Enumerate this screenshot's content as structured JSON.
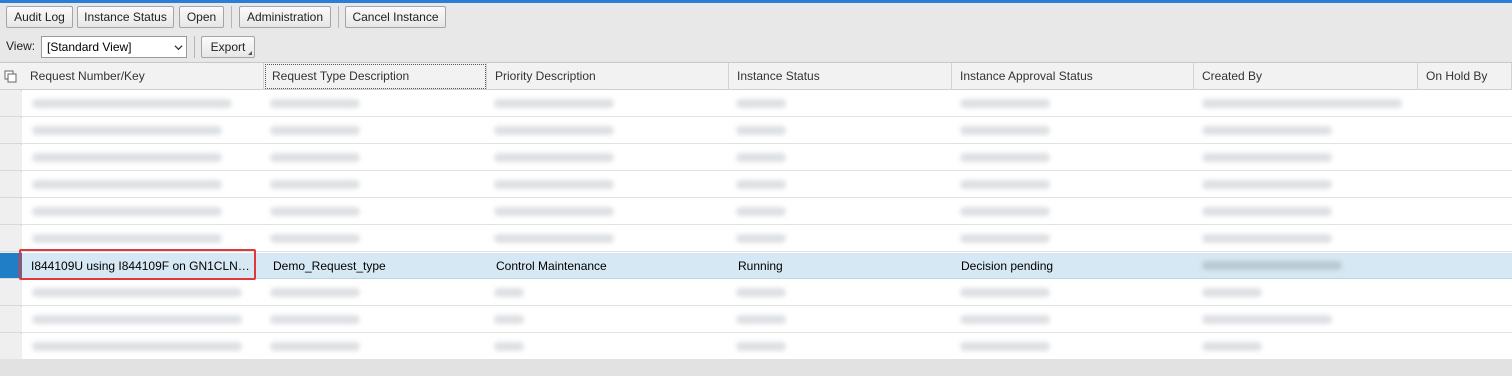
{
  "toolbar": {
    "audit_log": "Audit Log",
    "instance_status": "Instance Status",
    "open": "Open",
    "administration": "Administration",
    "cancel_instance": "Cancel Instance",
    "view_label": "View:",
    "view_value": "[Standard View]",
    "export": "Export"
  },
  "table": {
    "columns": [
      "Request Number/Key",
      "Request Type Description",
      "Priority Description",
      "Instance Status",
      "Instance Approval Status",
      "Created By",
      "On Hold By"
    ],
    "selected_row": {
      "request_key": "I844109U using I844109F on GN1CLN…",
      "request_type": "Demo_Request_type",
      "priority": "Control Maintenance",
      "instance_status": "Running",
      "approval_status": "Decision pending",
      "created_by": ""
    }
  },
  "colors": {
    "accent": "#2a7fd4",
    "selected_row": "#d6e8f3",
    "highlight_border": "#e0383a"
  }
}
